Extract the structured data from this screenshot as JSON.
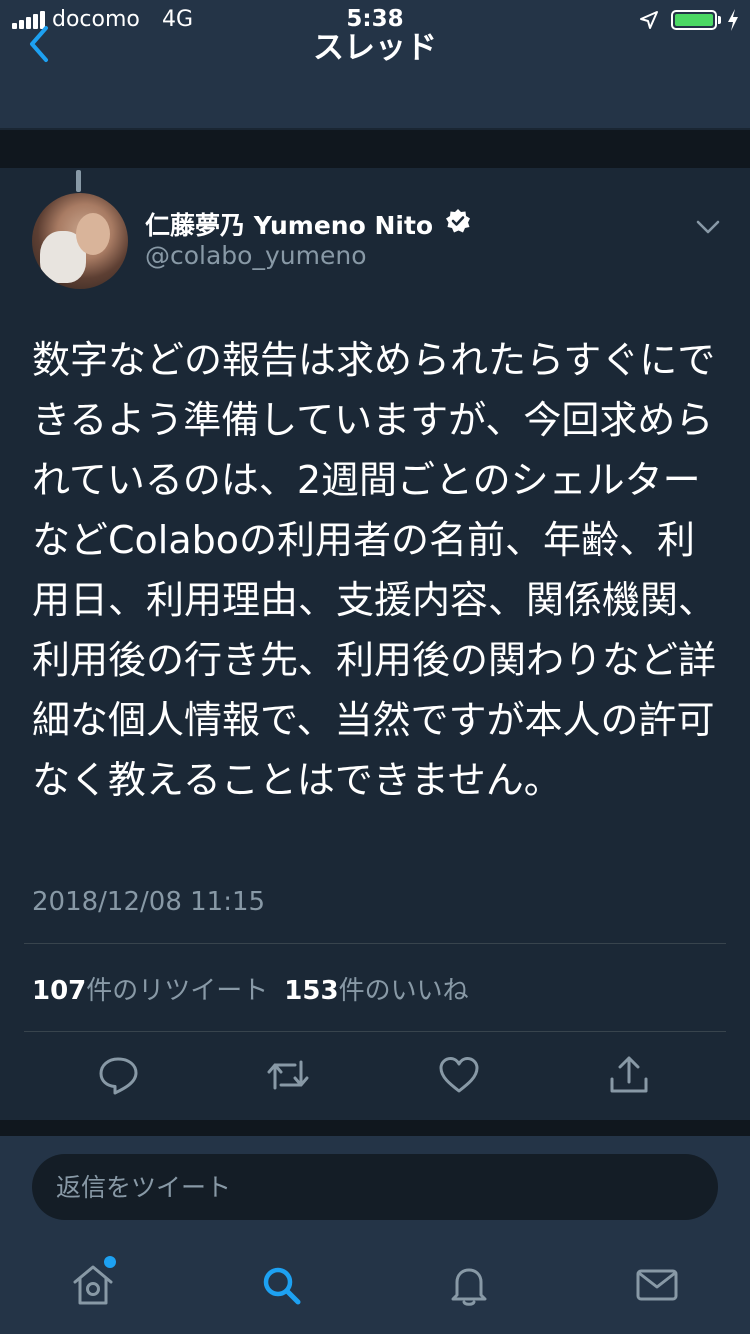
{
  "status_bar": {
    "carrier": "docomo",
    "network": "4G",
    "time": "5:38",
    "battery_level": 1.0,
    "icons": [
      "signal-icon",
      "location-arrow-icon",
      "battery-icon",
      "charging-icon"
    ]
  },
  "nav": {
    "title": "スレッド",
    "back_icon": "chevron-left-icon"
  },
  "tweet": {
    "display_name": "仁藤夢乃  Yumeno Nito",
    "handle": "@colabo_yumeno",
    "verified": true,
    "text": "数字などの報告は求められたらすぐにできるよう準備していますが、今回求められているのは、2週間ごとのシェルターなどColaboの利用者の名前、年齢、利用日、利用理由、支援内容、関係機関、利用後の行き先、利用後の関わりなど詳細な個人情報で、当然ですが本人の許可なく教えることはできません。",
    "timestamp": "2018/12/08 11:15",
    "retweet_count": "107",
    "retweet_label": "件のリツイート",
    "like_count": "153",
    "like_label": "件のいいね",
    "actions": [
      "reply-icon",
      "retweet-icon",
      "heart-icon",
      "share-icon"
    ]
  },
  "reply": {
    "placeholder": "返信をツイート"
  },
  "tabbar": {
    "items": [
      "home-icon",
      "search-icon",
      "bell-icon",
      "mail-icon"
    ],
    "home_has_badge": true
  },
  "colors": {
    "background": "#141d26",
    "bar": "#243447",
    "card": "#1b2836",
    "accent": "#1da1f2",
    "secondary_text": "#8899a6",
    "battery": "#4cd964"
  }
}
